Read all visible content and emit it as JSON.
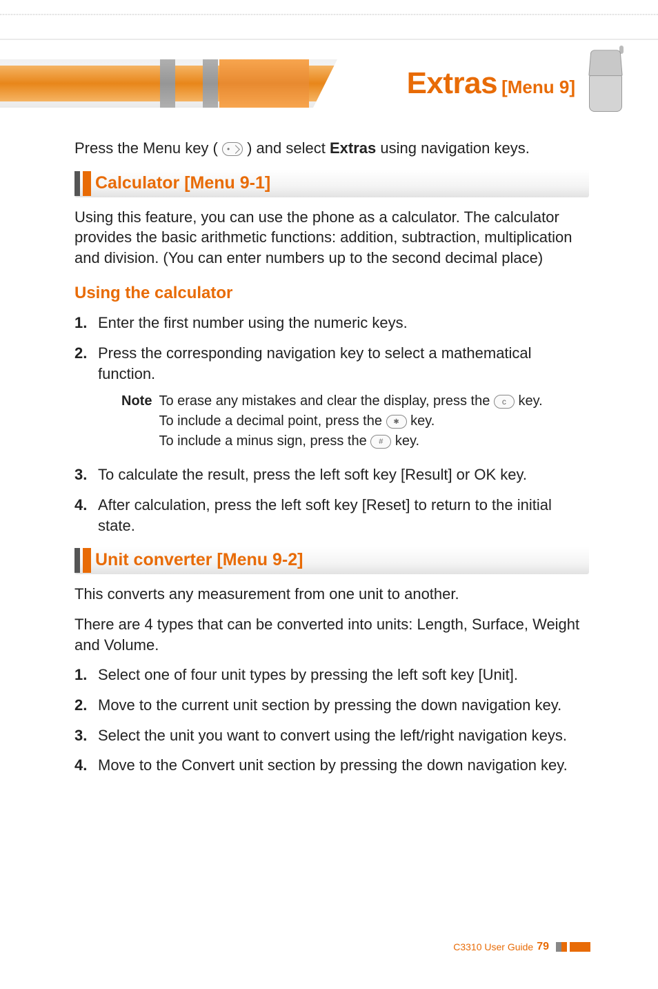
{
  "header": {
    "title": "Extras",
    "subtitle": "[Menu 9]"
  },
  "intro": {
    "pre": "Press the Menu key ( ",
    "post": " ) and select ",
    "strong": "Extras",
    "tail": " using navigation keys."
  },
  "section1": {
    "title": "Calculator [Menu 9-1]",
    "body": "Using this feature, you can use the phone as a calculator. The calculator provides the basic arithmetic functions: addition, subtraction, multiplication and division. (You can enter numbers up to the second decimal place)",
    "subhead": "Using the calculator",
    "steps": {
      "s1": "Enter the first number using the numeric keys.",
      "s2": "Press the corresponding navigation key to select a mathematical function.",
      "s3": "To calculate the result, press the left soft key [Result] or OK key.",
      "s4": "After calculation, press the left soft key [Reset] to return to the initial state."
    },
    "note": {
      "label": "Note",
      "l1a": "To erase any mistakes and clear the display, press the ",
      "l1b": " key.",
      "l2a": "To include a decimal point, press the ",
      "l2b": " key.",
      "l3a": "To include a minus sign, press the ",
      "l3b": " key."
    }
  },
  "section2": {
    "title": "Unit converter [Menu 9-2]",
    "p1": "This converts any measurement from one unit to another.",
    "p2": "There are 4 types that can be converted into units: Length, Surface, Weight and Volume.",
    "steps": {
      "s1": "Select one of four unit types by pressing the left soft key [Unit].",
      "s2": "Move to the current unit section by pressing the down navigation key.",
      "s3": "Select the unit you want to convert using the left/right navigation keys.",
      "s4": "Move to the Convert unit section by pressing the down navigation key."
    }
  },
  "footer": {
    "guide": "C3310 User Guide",
    "page": "79"
  }
}
